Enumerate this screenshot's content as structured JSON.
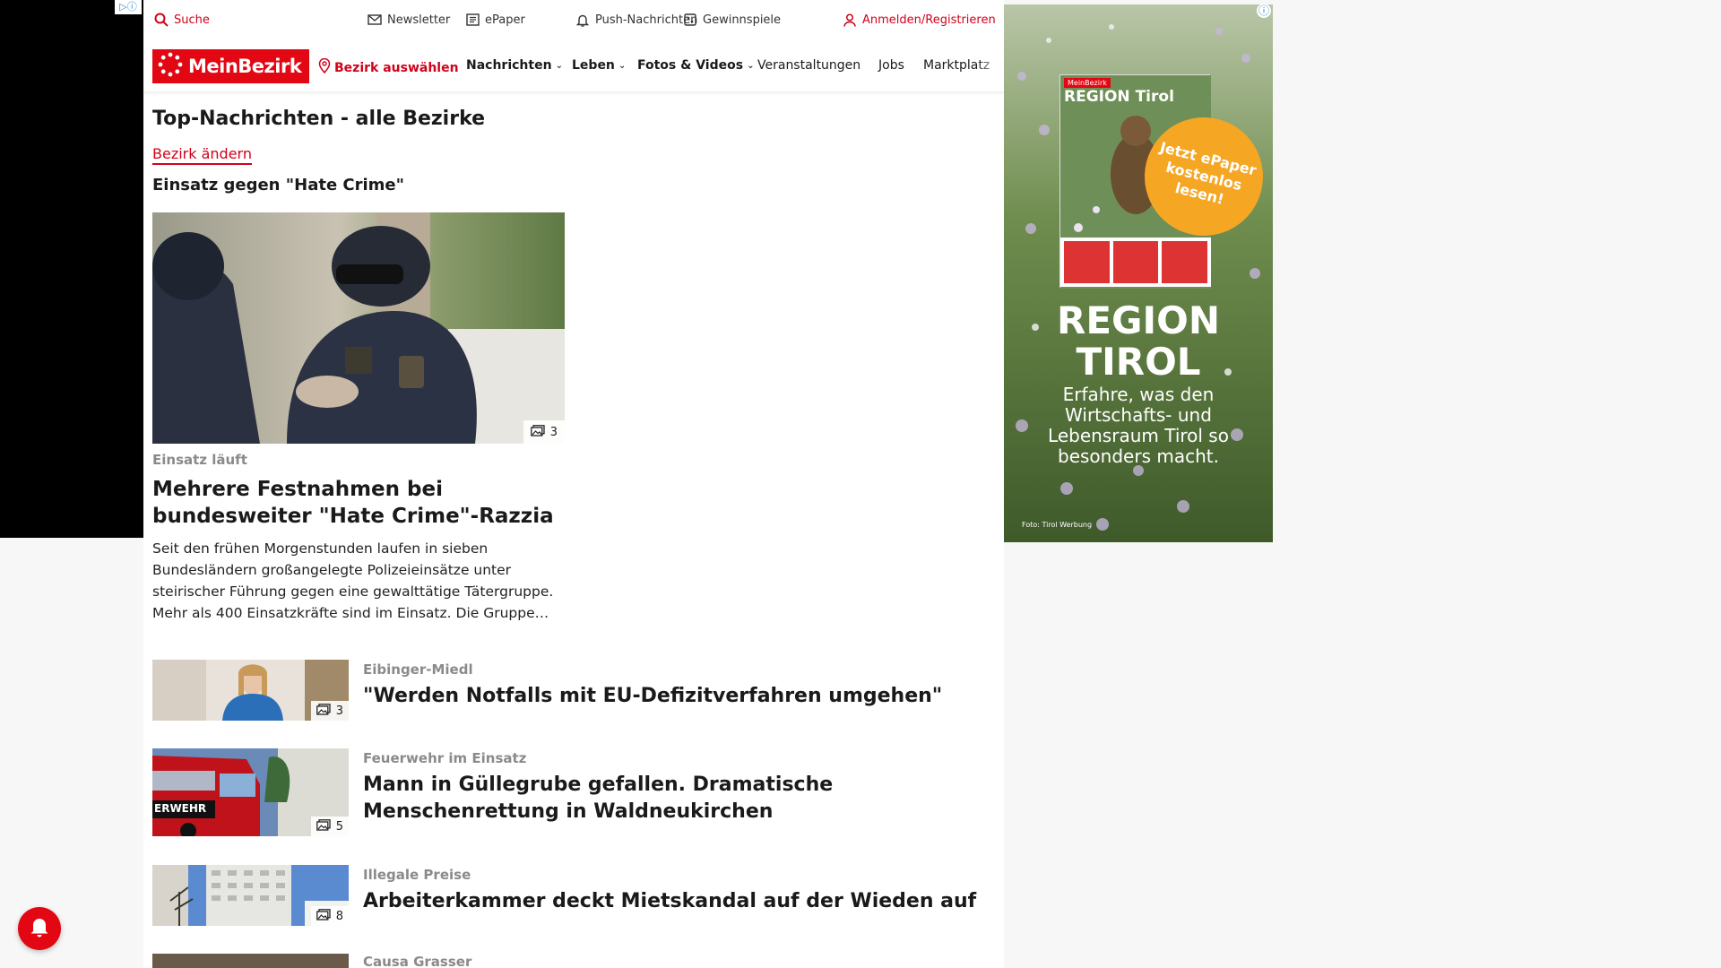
{
  "topbar": {
    "search": "Suche",
    "newsletter": "Newsletter",
    "epaper": "ePaper",
    "push": "Push-Nachrichten",
    "sweepstakes": "Gewinnspiele",
    "login": "Anmelden/Registrieren"
  },
  "nav": {
    "logo": "MeinBezirk",
    "district": "Bezirk auswählen",
    "items": [
      "Nachrichten",
      "Leben",
      "Fotos & Videos",
      "Veranstaltungen",
      "Jobs",
      "Marktplatz"
    ]
  },
  "content": {
    "section_title": "Top-Nachrichten - alle Bezirke",
    "change_district": "Bezirk ändern",
    "topic_title": "Einsatz gegen \"Hate Crime\""
  },
  "hero": {
    "photo_count": "3",
    "kicker": "Einsatz läuft",
    "title": "Mehrere Festnahmen bei bundesweiter \"Hate Crime\"-Razzia",
    "teaser": "Seit den frühen Morgenstunden laufen in sieben Bundesländern großangelegte Polizeieinsätze unter steirischer Führung gegen eine gewalttätige Tätergruppe. Mehr als 400 Einsatzkräfte sind im Einsatz. Die Gruppe…"
  },
  "articles": [
    {
      "kicker": "Eibinger-Miedl",
      "title": "\"Werden Notfalls mit EU-Defizitverfahren umgehen\"",
      "photo_count": "3"
    },
    {
      "kicker": "Feuerwehr im Einsatz",
      "title": "Mann in Güllegrube gefallen. Dramatische Menschenrettung in Waldneukirchen",
      "photo_count": "5"
    },
    {
      "kicker": "Illegale Preise",
      "title": "Arbeiterkammer deckt Mietskandal auf der Wieden auf",
      "photo_count": "8"
    },
    {
      "kicker": "Causa Grasser"
    }
  ],
  "ad_right": {
    "mag_logo": "MeinBezirk",
    "mag_title": "REGION Tirol",
    "circle": "Jetzt ePaper kostenlos lesen!",
    "headline_line1": "REGION",
    "headline_line2": "TIROL",
    "copy": "Erfahre, was den Wirtschafts- und Lebensraum Tirol so besonders macht.",
    "credit": "Foto: Tirol Werbung"
  },
  "colors": {
    "brand_red": "#e30613",
    "link_red": "#d0021b",
    "kicker_gray": "#8a8a8a",
    "ad_orange": "#f5a623"
  }
}
